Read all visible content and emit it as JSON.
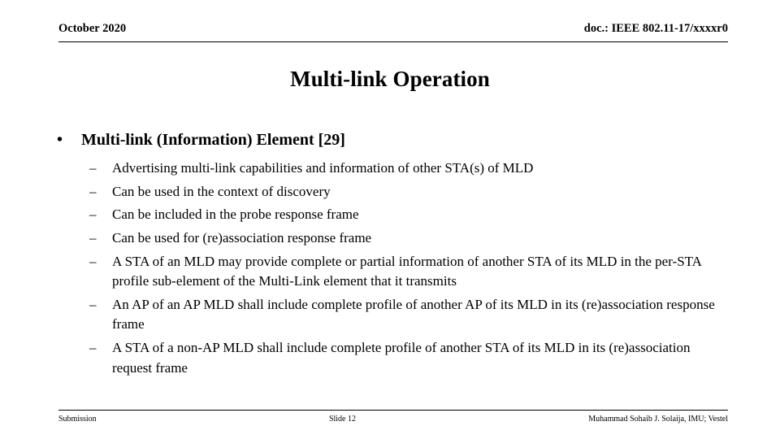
{
  "header": {
    "left": "October 2020",
    "right": "doc.: IEEE 802.11-17/xxxxr0"
  },
  "title": "Multi-link Operation",
  "body": {
    "bullet_marker": "•",
    "sub_marker": "–",
    "items": [
      {
        "label": "Multi-link (Information) Element [29]",
        "subitems": [
          "Advertising multi-link capabilities and information of other STA(s) of MLD",
          "Can be used in the context of discovery",
          "Can be included in the probe response frame",
          "Can be used for (re)association response frame",
          "A STA of an MLD may provide complete or partial information of another STA of its MLD in the per-STA profile sub-element of the Multi-Link element that it transmits",
          "An AP of an AP MLD shall include complete profile of another AP of its MLD in its (re)association response frame",
          "A STA of a non-AP MLD shall include complete profile of another STA of its MLD in its (re)association request frame"
        ]
      }
    ]
  },
  "footer": {
    "left": "Submission",
    "center": "Slide 12",
    "right": "Muhammad Sohaib J. Solaija, IMU; Vestel"
  }
}
